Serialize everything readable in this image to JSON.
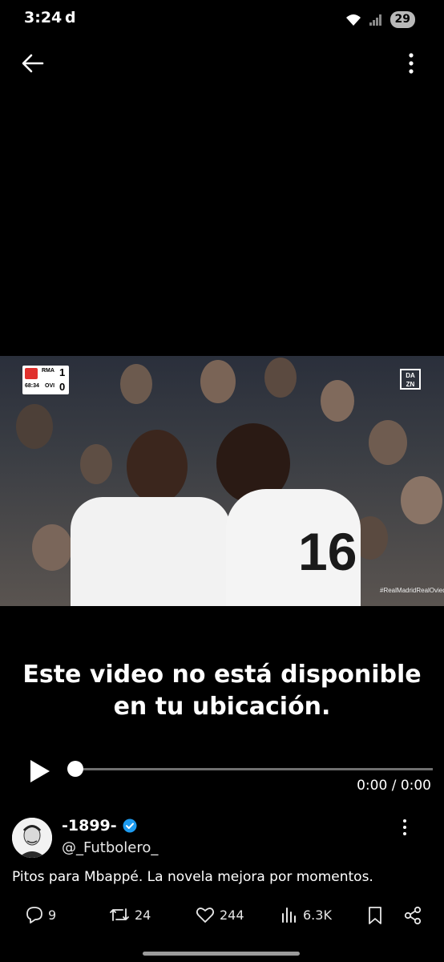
{
  "status_bar": {
    "time": "3:24",
    "app_indicator": "d",
    "battery": "29"
  },
  "video": {
    "scorebug": {
      "home_team": "RMA",
      "away_team": "OVI",
      "home_score": "1",
      "away_score": "0",
      "clock": "68:34"
    },
    "broadcaster": "DAZN",
    "hashtag": "#RealMadridRealOviedo",
    "unavailable_line1": "Este video no está disponible",
    "unavailable_line2": "en tu ubicación.",
    "time_display": "0:00 / 0:00",
    "progress": 0
  },
  "post": {
    "display_name": "-1899-",
    "handle": "@_Futbolero_",
    "text": "Pitos para Mbappé. La novela mejora por momentos.",
    "verified_color": "#1d9bf0"
  },
  "actions": {
    "replies": "9",
    "reposts": "24",
    "likes": "244",
    "views": "6.3K"
  }
}
